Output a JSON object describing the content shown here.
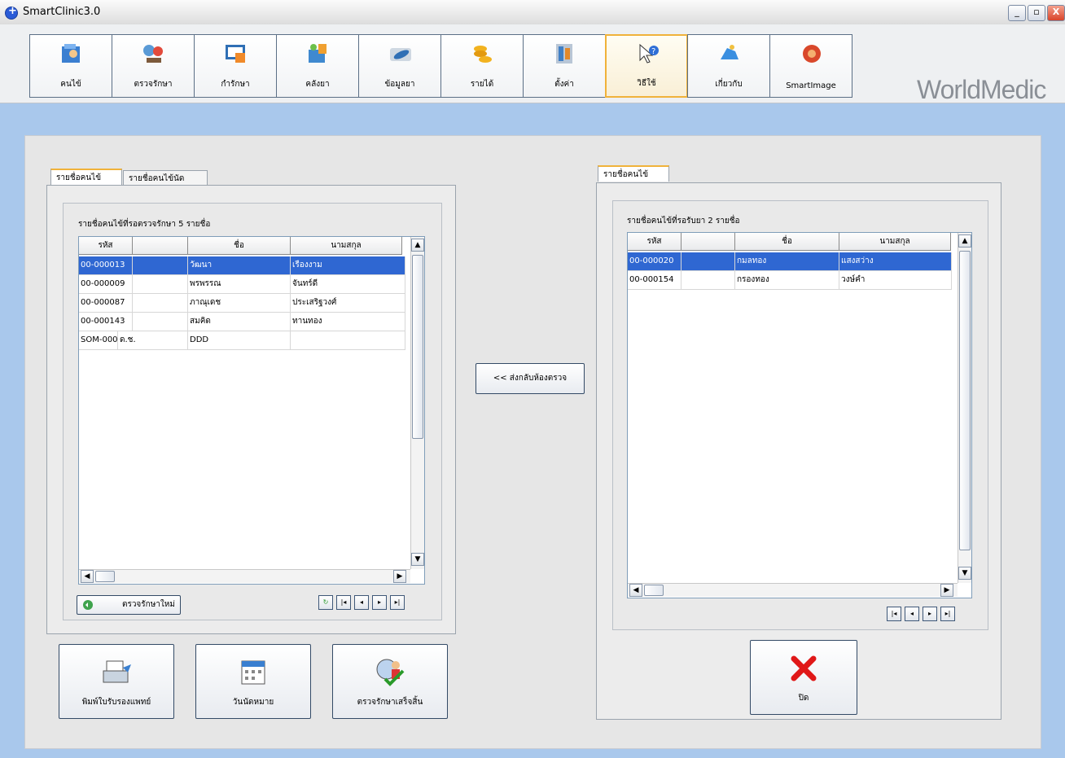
{
  "window": {
    "title": "SmartClinic3.0",
    "minimize": "_",
    "restore": "▫",
    "close": "X"
  },
  "toolbar": {
    "buttons": [
      {
        "label": "คนไข้",
        "icon": "patient-folder-icon"
      },
      {
        "label": "ตรวจรักษา",
        "icon": "examination-icon"
      },
      {
        "label": "กำรักษา",
        "icon": "treatment-icon"
      },
      {
        "label": "คลังยา",
        "icon": "pharmacy-icon"
      },
      {
        "label": "ข้อมูลยา",
        "icon": "drug-info-icon"
      },
      {
        "label": "รายได้",
        "icon": "coins-icon"
      },
      {
        "label": "ตั้งค่า",
        "icon": "settings-icon"
      },
      {
        "label": "วิธีใช้",
        "icon": "help-icon"
      },
      {
        "label": "เกี่ยวกับ",
        "icon": "about-icon"
      },
      {
        "label": "SmartImage",
        "icon": "smartimage-icon"
      }
    ],
    "brand": "WorldMedic"
  },
  "left_panel": {
    "tabs": [
      "รายชื่อคนไข้",
      "รายชื่อคนไข้นัด"
    ],
    "caption": "รายชื่อคนไข้ที่รอตรวจรักษา 5 รายชื่อ",
    "columns": [
      "รหัส",
      "",
      "ชื่อ",
      "นามสกุล"
    ],
    "rows": [
      [
        "00-000013",
        "",
        "วัฒนา",
        "เรืองงาม"
      ],
      [
        "00-000009",
        "",
        "พรพรรณ",
        "จันทร์ดี"
      ],
      [
        "00-000087",
        "",
        "ภาณุเดช",
        "ประเสริฐวงศ์"
      ],
      [
        "00-000143",
        "",
        "สมคิด",
        "ทานทอง"
      ],
      [
        "SOM-000",
        "ด.ช.",
        "DDD",
        ""
      ]
    ],
    "new_exam_button": "ตรวจรักษาใหม่",
    "nav": {
      "refresh": "↻",
      "first": "|◂",
      "prev": "◂",
      "next": "▸",
      "last": "▸|"
    }
  },
  "transfer_button": "<< ส่งกลับห้องตรวจ",
  "right_panel": {
    "tabs": [
      "รายชื่อคนไข้"
    ],
    "caption": "รายชื่อคนไข้ที่รอรับยา 2 รายชื่อ",
    "columns": [
      "รหัส",
      "",
      "ชื่อ",
      "นามสกุล"
    ],
    "rows": [
      [
        "00-000020",
        "",
        "กมลทอง",
        "แสงสว่าง"
      ],
      [
        "00-000154",
        "",
        "กรองทอง",
        "วงษ์คำ"
      ]
    ],
    "nav": {
      "first": "|◂",
      "prev": "◂",
      "next": "▸",
      "last": "▸|"
    }
  },
  "bottom_buttons": [
    {
      "label": "พิมพ์ใบรับรองแพทย์",
      "icon": "printer-icon"
    },
    {
      "label": "วันนัดหมาย",
      "icon": "calendar-icon"
    },
    {
      "label": "ตรวจรักษาเสร็จสิ้น",
      "icon": "doctor-check-icon"
    }
  ],
  "close_button": {
    "label": "ปิด",
    "icon": "red-x-icon"
  }
}
